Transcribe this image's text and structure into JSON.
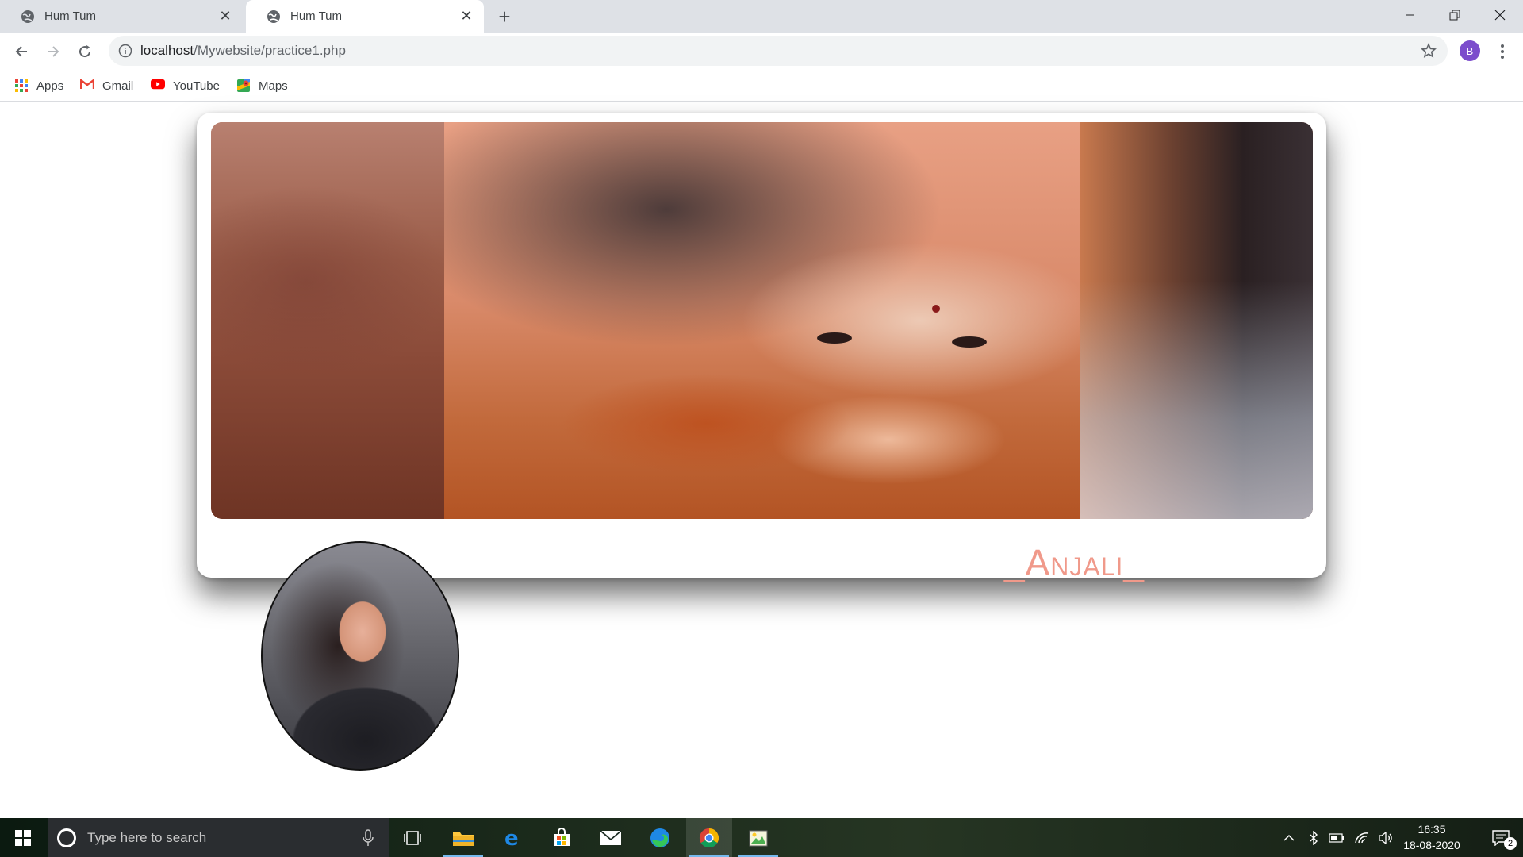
{
  "browser": {
    "tabs": [
      {
        "title": "Hum Tum",
        "active": false
      },
      {
        "title": "Hum Tum",
        "active": true
      }
    ],
    "new_tab_label": "+",
    "url_host": "localhost",
    "url_path": "/Mywebsite/practice1.php",
    "profile_initial": "B",
    "profile_color": "#7c4dcc",
    "bookmarks": [
      {
        "label": "Apps",
        "icon": "apps-grid-icon"
      },
      {
        "label": "Gmail",
        "icon": "gmail-icon"
      },
      {
        "label": "YouTube",
        "icon": "youtube-icon"
      },
      {
        "label": "Maps",
        "icon": "maps-icon"
      }
    ]
  },
  "profile": {
    "name": "_Anjali_",
    "name_color": "#f0998a"
  },
  "taskbar": {
    "search_placeholder": "Type here to search",
    "time": "16:35",
    "date": "18-08-2020",
    "notification_count": "2",
    "pinned_apps": [
      "task-view",
      "file-explorer",
      "edge-legacy",
      "microsoft-store",
      "mail",
      "edge-chromium",
      "chrome",
      "paint-app"
    ]
  }
}
